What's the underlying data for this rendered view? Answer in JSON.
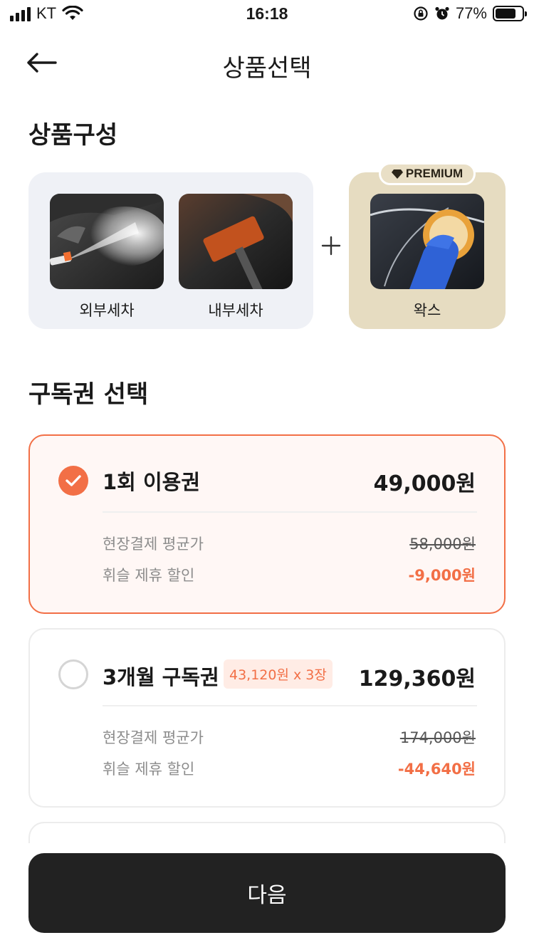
{
  "status_bar": {
    "carrier": "KT",
    "time": "16:18",
    "battery": "77%",
    "battery_level": 0.77
  },
  "header": {
    "title": "상품선택"
  },
  "composition": {
    "title": "상품구성",
    "items": [
      {
        "label": "외부세차"
      },
      {
        "label": "내부세차"
      }
    ],
    "premium": {
      "badge": "PREMIUM",
      "label": "왁스"
    }
  },
  "subscription": {
    "title": "구독권 선택",
    "plans": [
      {
        "name": "1회 이용권",
        "price": "49,000원",
        "selected": true,
        "avg_label": "현장결제 평균가",
        "avg_price": "58,000원",
        "discount_label": "휘슬 제휴 할인",
        "discount": "-9,000원"
      },
      {
        "name": "3개월 구독권",
        "tag": "43,120원 x 3장",
        "price": "129,360원",
        "selected": false,
        "avg_label": "현장결제 평균가",
        "avg_price": "174,000원",
        "discount_label": "휘슬 제휴 할인",
        "discount": "-44,640원"
      }
    ]
  },
  "next_button": {
    "label": "다음"
  },
  "colors": {
    "accent": "#f26f46",
    "premium_bg": "#e6dcc1",
    "basic_bg": "#eff1f6",
    "button_bg": "#222222"
  }
}
